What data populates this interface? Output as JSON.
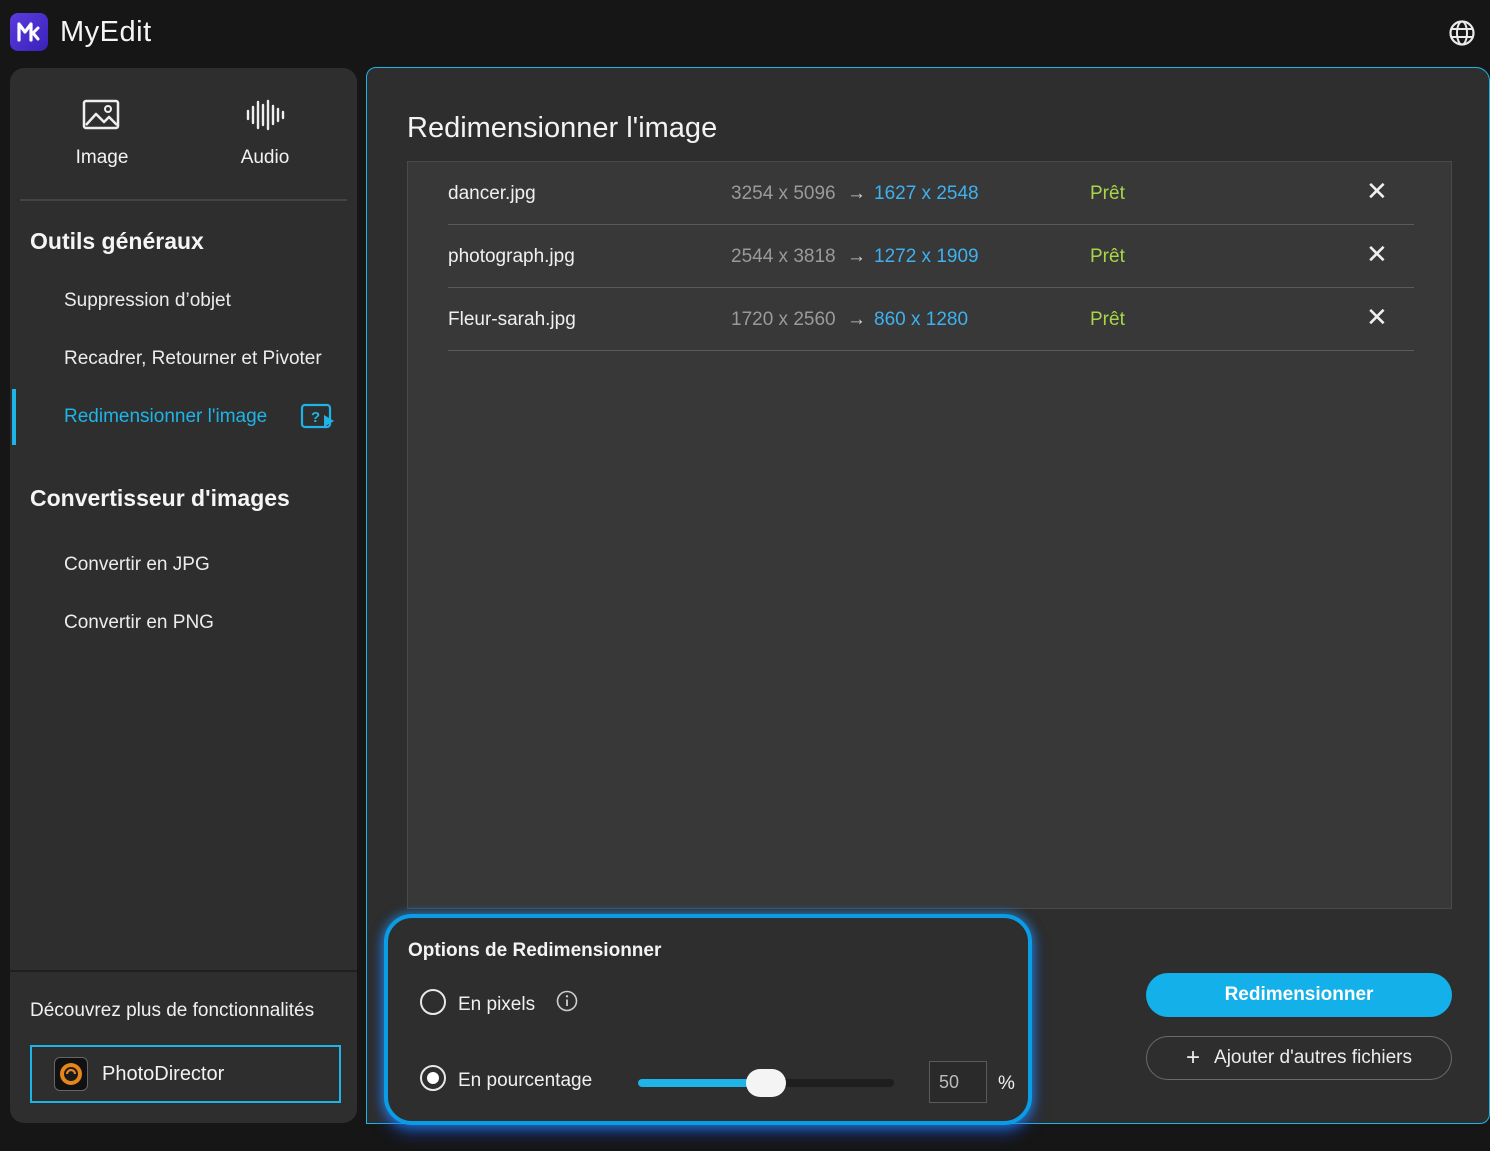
{
  "app": {
    "title": "MyEdit"
  },
  "modes": [
    {
      "label": "Image",
      "icon": "image-icon"
    },
    {
      "label": "Audio",
      "icon": "audio-waveform-icon"
    }
  ],
  "sidebar": {
    "general_heading": "Outils généraux",
    "general_items": [
      {
        "label": "Suppression d’objet"
      },
      {
        "label": "Recadrer, Retourner et Pivoter"
      },
      {
        "label": "Redimensionner l'image",
        "active": true
      }
    ],
    "converter_heading": "Convertisseur d'images",
    "converter_items": [
      {
        "label": "Convertir en JPG"
      },
      {
        "label": "Convertir en PNG"
      }
    ],
    "discover_label": "Découvrez plus de fonctionnalités",
    "promo_button": "PhotoDirector"
  },
  "main": {
    "title": "Redimensionner l'image",
    "files": [
      {
        "name": "dancer.jpg",
        "original": "3254 x 5096",
        "arrow": "→",
        "resized": "1627 x 2548",
        "status": "Prêt"
      },
      {
        "name": "photograph.jpg",
        "original": "2544 x 3818",
        "arrow": "→",
        "resized": "1272 x 1909",
        "status": "Prêt"
      },
      {
        "name": "Fleur-sarah.jpg",
        "original": "1720 x 2560",
        "arrow": "→",
        "resized": "860 x 1280",
        "status": "Prêt"
      }
    ],
    "remove_glyph": "✕"
  },
  "options": {
    "title": "Options de Redimensionner",
    "pixels_label": "En pixels",
    "percent_label": "En pourcentage",
    "selected": "percent",
    "percent_value": "50",
    "percent_sign": "%",
    "slider_fraction": 0.5
  },
  "actions": {
    "resize_label": "Redimensionner",
    "add_plus": "+",
    "add_files_label": "Ajouter d'autres fichiers"
  },
  "colors": {
    "accent": "#1eb4e8",
    "status_ready": "#a8d64a",
    "resized_dim": "#3eb1ee"
  }
}
